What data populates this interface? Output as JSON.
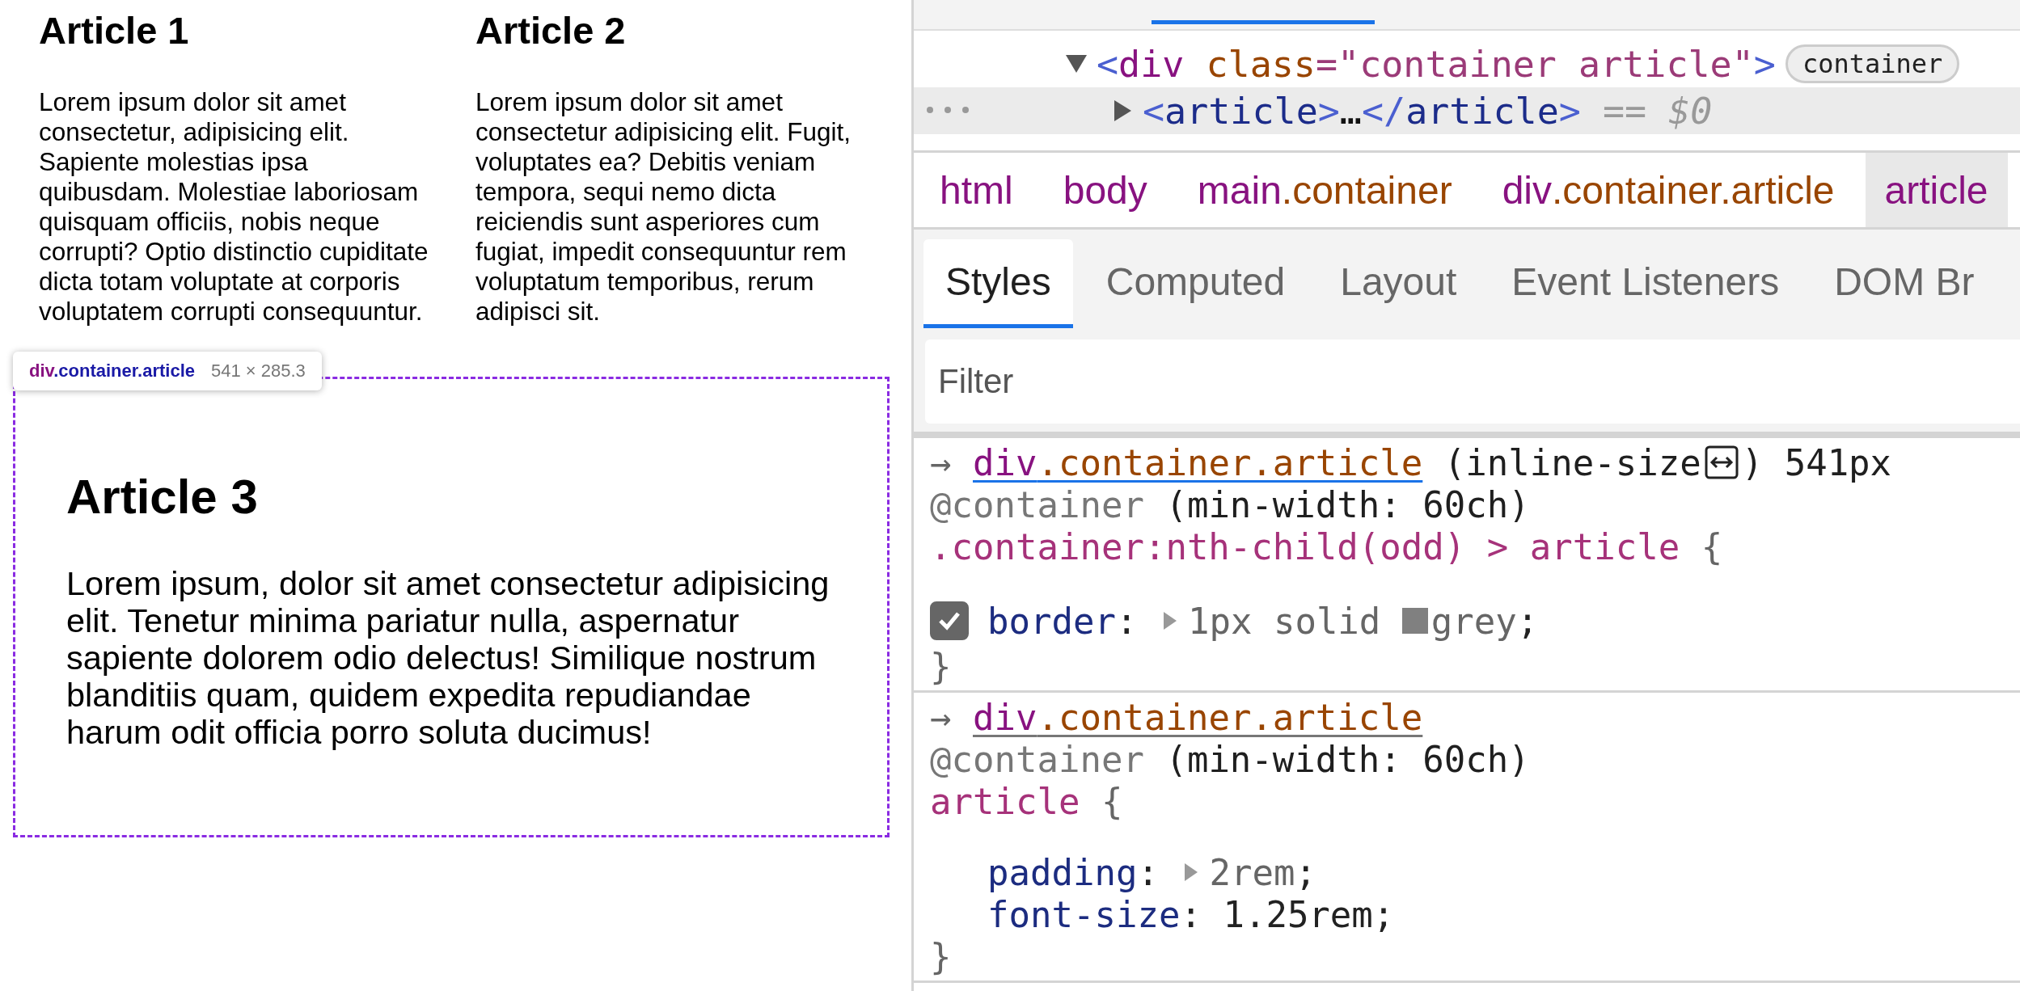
{
  "page": {
    "rows": [
      {
        "articles": [
          {
            "title": "Article 1",
            "body": "Lorem ipsum dolor sit amet consectetur, adipisicing elit. Sapiente molestias ipsa quibusdam. Molestiae laboriosam quisquam officiis, nobis neque corrupti? Optio distinctio cupiditate dicta totam voluptate at corporis voluptatem corrupti consequuntur.",
            "highlighted": false
          },
          {
            "title": "Article 2",
            "body": "Lorem ipsum dolor sit amet consectetur adipisicing elit. Fugit, voluptates ea? Debitis veniam tempora, sequi nemo dicta reiciendis sunt asperiores cum fugiat, impedit consequuntur rem voluptatum temporibus, rerum adipisci sit.",
            "highlighted": false
          }
        ]
      },
      {
        "articles": [
          {
            "title": "Article 3",
            "body": "Lorem ipsum, dolor sit amet consectetur adipisicing elit. Tenetur minima pariatur nulla, aspernatur sapiente dolorem odio delectus! Similique nostrum blanditiis quam, quidem expedita repudiandae harum odit officia porro soluta ducimus!",
            "highlighted": true
          }
        ]
      }
    ],
    "tooltip": {
      "tag": "div",
      "classes": ".container.article",
      "size": "541 × 285.3"
    }
  },
  "devtools": {
    "dom_tree": {
      "nodes": [
        {
          "expanded": true,
          "selected": false,
          "badge": "container",
          "tokens": [
            {
              "kind": "bracket",
              "text": "<"
            },
            {
              "kind": "tag",
              "text": "div"
            },
            {
              "kind": "attr",
              "text": " class"
            },
            {
              "kind": "punct",
              "text": "=\""
            },
            {
              "kind": "attr_value",
              "text": "container article"
            },
            {
              "kind": "punct",
              "text": "\""
            },
            {
              "kind": "bracket",
              "text": ">"
            }
          ],
          "children": [
            {
              "expanded": false,
              "selected": true,
              "tokens": [
                {
                  "kind": "bracket",
                  "text": "<"
                },
                {
                  "kind": "tag_sel",
                  "text": "article"
                },
                {
                  "kind": "bracket",
                  "text": ">"
                },
                {
                  "kind": "ellipsis",
                  "text": "…"
                },
                {
                  "kind": "bracket",
                  "text": "</"
                },
                {
                  "kind": "tag_sel",
                  "text": "article"
                },
                {
                  "kind": "bracket",
                  "text": ">"
                },
                {
                  "kind": "console_ref",
                  "text": " == $0"
                }
              ]
            }
          ]
        }
      ]
    },
    "breadcrumbs": [
      {
        "selected": false,
        "parts": [
          {
            "kind": "tag",
            "text": "html"
          }
        ]
      },
      {
        "selected": false,
        "parts": [
          {
            "kind": "tag",
            "text": "body"
          }
        ]
      },
      {
        "selected": false,
        "parts": [
          {
            "kind": "tag",
            "text": "main"
          },
          {
            "kind": "class",
            "text": ".container"
          }
        ]
      },
      {
        "selected": false,
        "parts": [
          {
            "kind": "tag",
            "text": "div"
          },
          {
            "kind": "class",
            "text": ".container.article"
          }
        ]
      },
      {
        "selected": true,
        "parts": [
          {
            "kind": "tag",
            "text": "article"
          }
        ]
      }
    ],
    "tabs": [
      {
        "label": "Styles",
        "selected": true
      },
      {
        "label": "Computed",
        "selected": false
      },
      {
        "label": "Layout",
        "selected": false
      },
      {
        "label": "Event Listeners",
        "selected": false
      },
      {
        "label": "DOM Br",
        "selected": false
      }
    ],
    "filter": {
      "placeholder": "Filter"
    },
    "rules": [
      {
        "lines": [
          {
            "kind": "code",
            "tokens": [
              {
                "kind": "arrow",
                "text": "→ "
              },
              {
                "kind": "link",
                "hovered": true,
                "parts": [
                  {
                    "kind": "tag",
                    "text": "div"
                  },
                  {
                    "kind": "class",
                    "text": ".container.article"
                  }
                ]
              },
              {
                "kind": "plain",
                "text": " (inline-size"
              },
              {
                "kind": "size_icon"
              },
              {
                "kind": "plain",
                "text": ") 541px"
              }
            ]
          },
          {
            "kind": "code",
            "tokens": [
              {
                "kind": "at",
                "text": "@container"
              },
              {
                "kind": "plain",
                "text": " (min-width: 60ch)"
              }
            ]
          },
          {
            "kind": "code",
            "tokens": [
              {
                "kind": "selector",
                "text": ".container:nth-child(odd) > article"
              },
              {
                "kind": "brace",
                "text": " {"
              }
            ]
          },
          {
            "kind": "blank"
          },
          {
            "kind": "declaration",
            "tokens": [
              {
                "kind": "checkbox",
                "checked": true
              },
              {
                "kind": "prop",
                "text": "border"
              },
              {
                "kind": "colon",
                "text": ": "
              },
              {
                "kind": "expander"
              },
              {
                "kind": "value_dim",
                "text": "1px solid "
              },
              {
                "kind": "swatch",
                "color": "#808080"
              },
              {
                "kind": "value_dim",
                "text": "grey"
              },
              {
                "kind": "colon",
                "text": ";"
              }
            ]
          },
          {
            "kind": "code",
            "tokens": [
              {
                "kind": "brace",
                "text": "}"
              }
            ]
          }
        ]
      },
      {
        "lines": [
          {
            "kind": "code",
            "tokens": [
              {
                "kind": "arrow",
                "text": "→ "
              },
              {
                "kind": "link",
                "hovered": false,
                "parts": [
                  {
                    "kind": "tag",
                    "text": "div"
                  },
                  {
                    "kind": "class",
                    "text": ".container.article"
                  }
                ]
              }
            ]
          },
          {
            "kind": "code",
            "tokens": [
              {
                "kind": "at",
                "text": "@container"
              },
              {
                "kind": "plain",
                "text": " (min-width: 60ch)"
              }
            ]
          },
          {
            "kind": "code",
            "tokens": [
              {
                "kind": "selector",
                "text": "article"
              },
              {
                "kind": "brace",
                "text": " {"
              }
            ]
          },
          {
            "kind": "blank"
          },
          {
            "kind": "declaration",
            "tokens": [
              {
                "kind": "prop",
                "text": "padding"
              },
              {
                "kind": "colon",
                "text": ": "
              },
              {
                "kind": "expander"
              },
              {
                "kind": "value_dim",
                "text": "2rem"
              },
              {
                "kind": "colon",
                "text": ";"
              }
            ]
          },
          {
            "kind": "declaration",
            "tokens": [
              {
                "kind": "prop",
                "text": "font-size"
              },
              {
                "kind": "colon",
                "text": ": "
              },
              {
                "kind": "value",
                "text": "1.25rem"
              },
              {
                "kind": "colon",
                "text": ";"
              }
            ]
          },
          {
            "kind": "code",
            "tokens": [
              {
                "kind": "brace",
                "text": "}"
              }
            ]
          }
        ]
      }
    ]
  }
}
